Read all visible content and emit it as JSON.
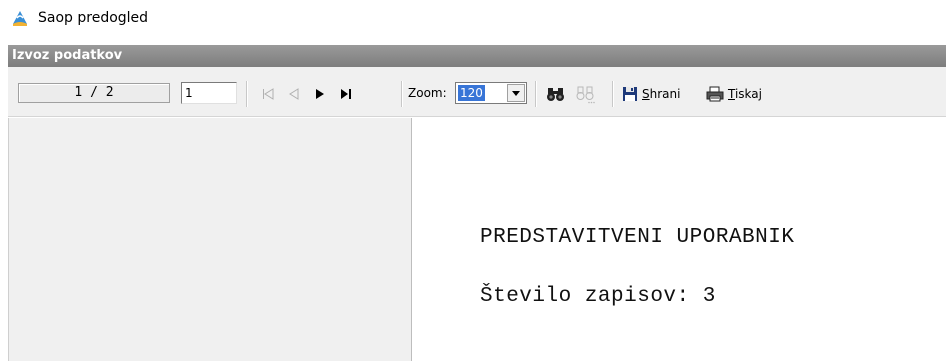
{
  "window": {
    "title": "Saop predogled",
    "icon": "saop-app-icon"
  },
  "section": {
    "header": "Izvoz podatkov"
  },
  "toolbar": {
    "page_counter": "1 / 2",
    "page_input_value": "1",
    "nav": {
      "first": {
        "icon": "first-page-icon",
        "enabled": false
      },
      "prev": {
        "icon": "prev-page-icon",
        "enabled": false
      },
      "next": {
        "icon": "next-page-icon",
        "enabled": true
      },
      "last": {
        "icon": "last-page-icon",
        "enabled": true
      }
    },
    "zoom_label": "Zoom:",
    "zoom_value": "120",
    "find_icon": "binoculars-icon",
    "find_next_icon": "find-next-icon",
    "save": {
      "prefix": "S",
      "rest": "hrani",
      "icon": "floppy-disk-icon"
    },
    "print": {
      "prefix": "T",
      "rest": "iskaj",
      "icon": "printer-icon"
    }
  },
  "document": {
    "heading": "PREDSTAVITVENI UPORABNIK",
    "record_count": "Število zapisov: 3"
  },
  "colors": {
    "header_bg": "#8a8a8a",
    "toolbar_bg": "#f0f0f0",
    "selection": "#3875d7"
  }
}
